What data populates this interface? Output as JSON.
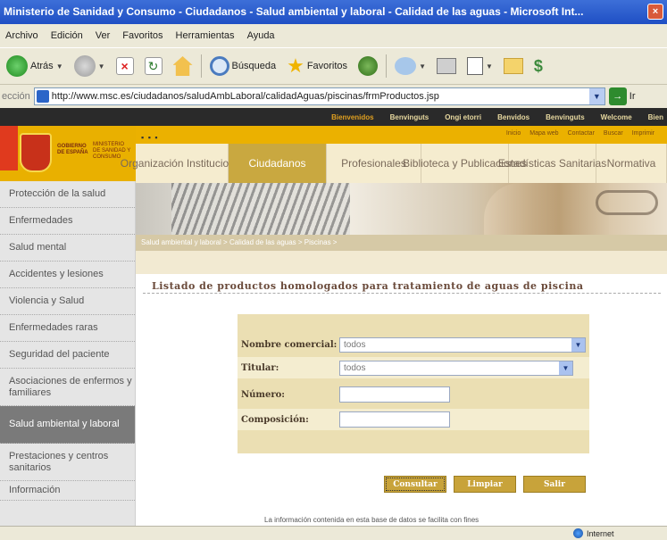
{
  "window": {
    "title": "Ministerio de Sanidad y Consumo - Ciudadanos - Salud ambiental y laboral - Calidad de las aguas - Microsoft Int..."
  },
  "menu": [
    "Archivo",
    "Edición",
    "Ver",
    "Favoritos",
    "Herramientas",
    "Ayuda"
  ],
  "toolbar": {
    "back_label": "Atrás",
    "search_label": "Búsqueda",
    "favorites_label": "Favoritos"
  },
  "address": {
    "label": "ección",
    "url": "http://www.msc.es/ciudadanos/saludAmbLaboral/calidadAguas/piscinas/frmProductos.jsp",
    "go_label": "Ir"
  },
  "site_top_links": [
    "Bienvenidos",
    "Benvinguts",
    "Ongi etorri",
    "Benvidos",
    "Benvinguts",
    "Welcome",
    "Bien"
  ],
  "header_links": [
    "Inicio",
    "Mapa web",
    "Contactar",
    "Buscar",
    "Imprimir"
  ],
  "logo": {
    "gov_text": "GOBIERNO DE ESPAÑA",
    "ministry_text": "MINISTERIO DE SANIDAD Y CONSUMO"
  },
  "nav_tabs": [
    {
      "label": "Organización Institucional"
    },
    {
      "label": "Ciudadanos"
    },
    {
      "label": "Profesionales"
    },
    {
      "label": "Biblioteca y Publicaciones"
    },
    {
      "label": "Estadísticas Sanitarias"
    },
    {
      "label": "Normativa"
    }
  ],
  "breadcrumb": "Salud ambiental y laboral > Calidad de las aguas > Piscinas >",
  "sidebar": [
    "Protección de la salud",
    "Enfermedades",
    "Salud mental",
    "Accidentes y lesiones",
    "Violencia y Salud",
    "Enfermedades raras",
    "Seguridad del paciente",
    "Asociaciones de enfermos y familiares",
    "Salud ambiental y laboral",
    "Prestaciones y centros sanitarios",
    "Información"
  ],
  "page_title": "Listado de productos homologados para tratamiento de aguas de piscina",
  "form": {
    "nombre_label": "Nombre comercial:",
    "nombre_value": "todos",
    "titular_label": "Titular:",
    "titular_value": "todos",
    "numero_label": "Número:",
    "numero_value": "",
    "composicion_label": "Composición:",
    "composicion_value": ""
  },
  "buttons": {
    "consultar": "Consultar",
    "limpiar": "Limpiar",
    "salir": "Salir"
  },
  "footnote": "La información contenida en esta base de datos se facilita con fines",
  "status": {
    "zone": "Internet"
  }
}
